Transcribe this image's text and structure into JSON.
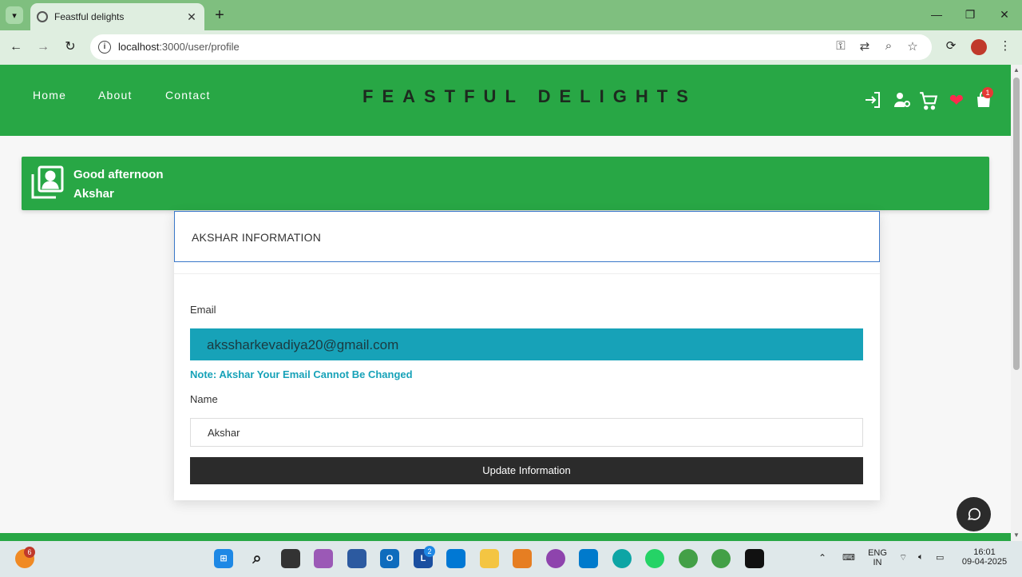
{
  "browser": {
    "tab_title": "Feastful delights",
    "url_host": "localhost",
    "url_path": ":3000/user/profile",
    "new_tab_label": "+",
    "close_tab_label": "✕"
  },
  "site": {
    "nav": [
      "Home",
      "About",
      "Contact"
    ],
    "brand": "FEASTFUL DELIGHTS",
    "cart_badge": "1",
    "colors": {
      "header_green": "#28a745",
      "email_teal": "#17a2b8",
      "button_dark": "#2b2b2b"
    }
  },
  "greeting": {
    "line1": "Good afternoon",
    "line2": "Akshar"
  },
  "profile": {
    "card_title": "AKSHAR INFORMATION",
    "email_label": "Email",
    "email_value": "akssharkevadiya20@gmail.com",
    "email_note": "Note: Akshar Your Email Cannot Be Changed",
    "name_label": "Name",
    "name_value": "Akshar",
    "update_button": "Update Information"
  },
  "taskbar": {
    "notif_badge": "6",
    "l_badge": "2",
    "lang_line1": "ENG",
    "lang_line2": "IN",
    "time": "16:01",
    "date": "09-04-2025"
  }
}
